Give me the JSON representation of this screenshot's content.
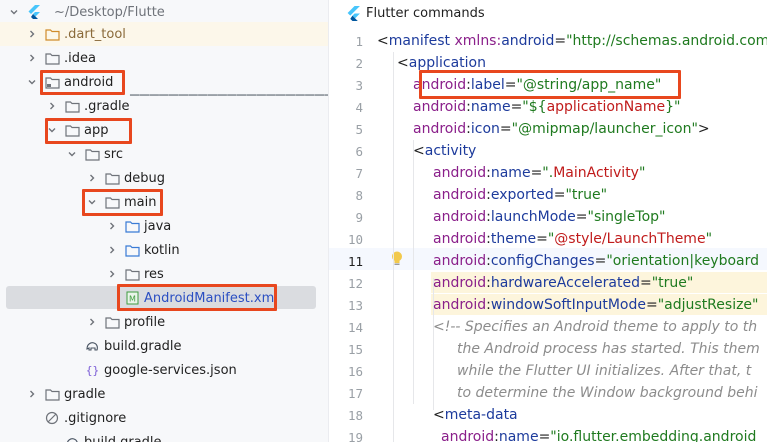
{
  "project_tree": {
    "root": {
      "name": "",
      "path": "~/Desktop/Flutte"
    },
    "items": [
      {
        "label": ".dart_tool",
        "icon": "folder-icon",
        "type": "folder",
        "expanded": false,
        "highlighted": false
      },
      {
        "label": ".idea",
        "icon": "folder-icon",
        "type": "folder",
        "expanded": false,
        "highlighted": false
      },
      {
        "label": "android",
        "icon": "folder-icon",
        "type": "folder",
        "expanded": true,
        "highlighted": true
      },
      {
        "label": ".gradle",
        "icon": "folder-icon",
        "type": "folder",
        "expanded": false,
        "highlighted": false
      },
      {
        "label": "app",
        "icon": "folder-icon",
        "type": "folder",
        "expanded": true,
        "highlighted": true
      },
      {
        "label": "src",
        "icon": "folder-icon",
        "type": "folder",
        "expanded": true,
        "highlighted": false
      },
      {
        "label": "debug",
        "icon": "folder-icon",
        "type": "folder",
        "expanded": false,
        "highlighted": false
      },
      {
        "label": "main",
        "icon": "folder-icon",
        "type": "folder",
        "expanded": true,
        "highlighted": true
      },
      {
        "label": "java",
        "icon": "folder-icon",
        "type": "folder",
        "expanded": false,
        "highlighted": false
      },
      {
        "label": "kotlin",
        "icon": "folder-icon",
        "type": "folder",
        "expanded": false,
        "highlighted": false
      },
      {
        "label": "res",
        "icon": "folder-icon",
        "type": "folder",
        "expanded": false,
        "highlighted": false
      },
      {
        "label": "AndroidManifest.xml",
        "icon": "manifest-file-icon",
        "type": "file",
        "selected": true,
        "highlighted": true
      },
      {
        "label": "profile",
        "icon": "folder-icon",
        "type": "folder",
        "expanded": false,
        "highlighted": false
      },
      {
        "label": "build.gradle",
        "icon": "gradle-file-icon",
        "type": "file",
        "highlighted": false
      },
      {
        "label": "google-services.json",
        "icon": "json-file-icon",
        "type": "file",
        "highlighted": false
      },
      {
        "label": "gradle",
        "icon": "folder-icon",
        "type": "folder",
        "expanded": false,
        "highlighted": false
      },
      {
        "label": ".gitignore",
        "icon": "ignore-file-icon",
        "type": "file",
        "highlighted": false
      },
      {
        "label": "build.gradle",
        "icon": "gradle-file-icon",
        "type": "file",
        "highlighted": false
      }
    ]
  },
  "editor": {
    "tab_label": "Flutter commands",
    "line_numbers": [
      "1",
      "2",
      "3",
      "4",
      "5",
      "6",
      "7",
      "8",
      "9",
      "10",
      "11",
      "12",
      "13",
      "14",
      "15",
      "16",
      "17",
      "18",
      "19"
    ],
    "current_line": "11",
    "lines": [
      [
        [
          "punct",
          "<"
        ],
        [
          "tag",
          "manifest "
        ],
        [
          "ns",
          "xmlns:"
        ],
        [
          "attr",
          "android"
        ],
        [
          "punct",
          "="
        ],
        [
          "str",
          "\"http://schemas.android.com"
        ]
      ],
      [
        [
          "punct",
          "<"
        ],
        [
          "tag",
          "application"
        ]
      ],
      [
        [
          "ns",
          "android"
        ],
        [
          "punct",
          ":"
        ],
        [
          "attr",
          "label"
        ],
        [
          "punct",
          "="
        ],
        [
          "str",
          "\"@string/app_name\""
        ]
      ],
      [
        [
          "ns",
          "android"
        ],
        [
          "punct",
          ":"
        ],
        [
          "attr",
          "name"
        ],
        [
          "punct",
          "="
        ],
        [
          "str",
          "\"${"
        ],
        [
          "var",
          "applicationName"
        ],
        [
          "str",
          "}\""
        ]
      ],
      [
        [
          "ns",
          "android"
        ],
        [
          "punct",
          ":"
        ],
        [
          "attr",
          "icon"
        ],
        [
          "punct",
          "="
        ],
        [
          "str",
          "\"@mipmap/launcher_icon\""
        ],
        [
          "punct",
          ">"
        ]
      ],
      [
        [
          "punct",
          "<"
        ],
        [
          "tag",
          "activity"
        ]
      ],
      [
        [
          "ns",
          "android"
        ],
        [
          "punct",
          ":"
        ],
        [
          "attr",
          "name"
        ],
        [
          "punct",
          "="
        ],
        [
          "str",
          "\"."
        ],
        [
          "var",
          "MainActivity"
        ],
        [
          "str",
          "\""
        ]
      ],
      [
        [
          "ns",
          "android"
        ],
        [
          "punct",
          ":"
        ],
        [
          "attr",
          "exported"
        ],
        [
          "punct",
          "="
        ],
        [
          "str",
          "\"true\""
        ]
      ],
      [
        [
          "ns",
          "android"
        ],
        [
          "punct",
          ":"
        ],
        [
          "attr",
          "launchMode"
        ],
        [
          "punct",
          "="
        ],
        [
          "str",
          "\"singleTop\""
        ]
      ],
      [
        [
          "ns",
          "android"
        ],
        [
          "punct",
          ":"
        ],
        [
          "attr",
          "theme"
        ],
        [
          "punct",
          "="
        ],
        [
          "str",
          "\""
        ],
        [
          "var",
          "@style/LaunchTheme"
        ],
        [
          "str",
          "\""
        ]
      ],
      [
        [
          "ns",
          "android"
        ],
        [
          "punct",
          ":"
        ],
        [
          "attr",
          "configChanges"
        ],
        [
          "punct",
          "="
        ],
        [
          "str",
          "\"orientation|keyboard"
        ]
      ],
      [
        [
          "ns",
          "android"
        ],
        [
          "punct",
          ":"
        ],
        [
          "attr",
          "hardwareAccelerated"
        ],
        [
          "punct",
          "="
        ],
        [
          "str",
          "\"true\""
        ]
      ],
      [
        [
          "ns",
          "android"
        ],
        [
          "punct",
          ":"
        ],
        [
          "attr",
          "windowSoftInputMode"
        ],
        [
          "punct",
          "="
        ],
        [
          "str",
          "\"adjustResize\""
        ]
      ],
      [
        [
          "cmt",
          "<!-- Specifies an Android theme to apply to th"
        ]
      ],
      [
        [
          "cmt",
          "the Android process has started. This them"
        ]
      ],
      [
        [
          "cmt",
          "while the Flutter UI initializes. After that, t"
        ]
      ],
      [
        [
          "cmt",
          "to determine the Window background behi"
        ]
      ],
      [
        [
          "punct",
          "<"
        ],
        [
          "tag",
          "meta-data"
        ]
      ],
      [
        [
          "ns",
          "android"
        ],
        [
          "punct",
          ":"
        ],
        [
          "attr",
          "name"
        ],
        [
          "punct",
          "="
        ],
        [
          "str",
          "\"io.flutter.embedding.android"
        ]
      ]
    ]
  },
  "colors": {
    "highlight_box": "#e8471e",
    "selection": "#dadce0",
    "current_line": "#f5f8fe",
    "warning_line": "#fdf5dc"
  }
}
